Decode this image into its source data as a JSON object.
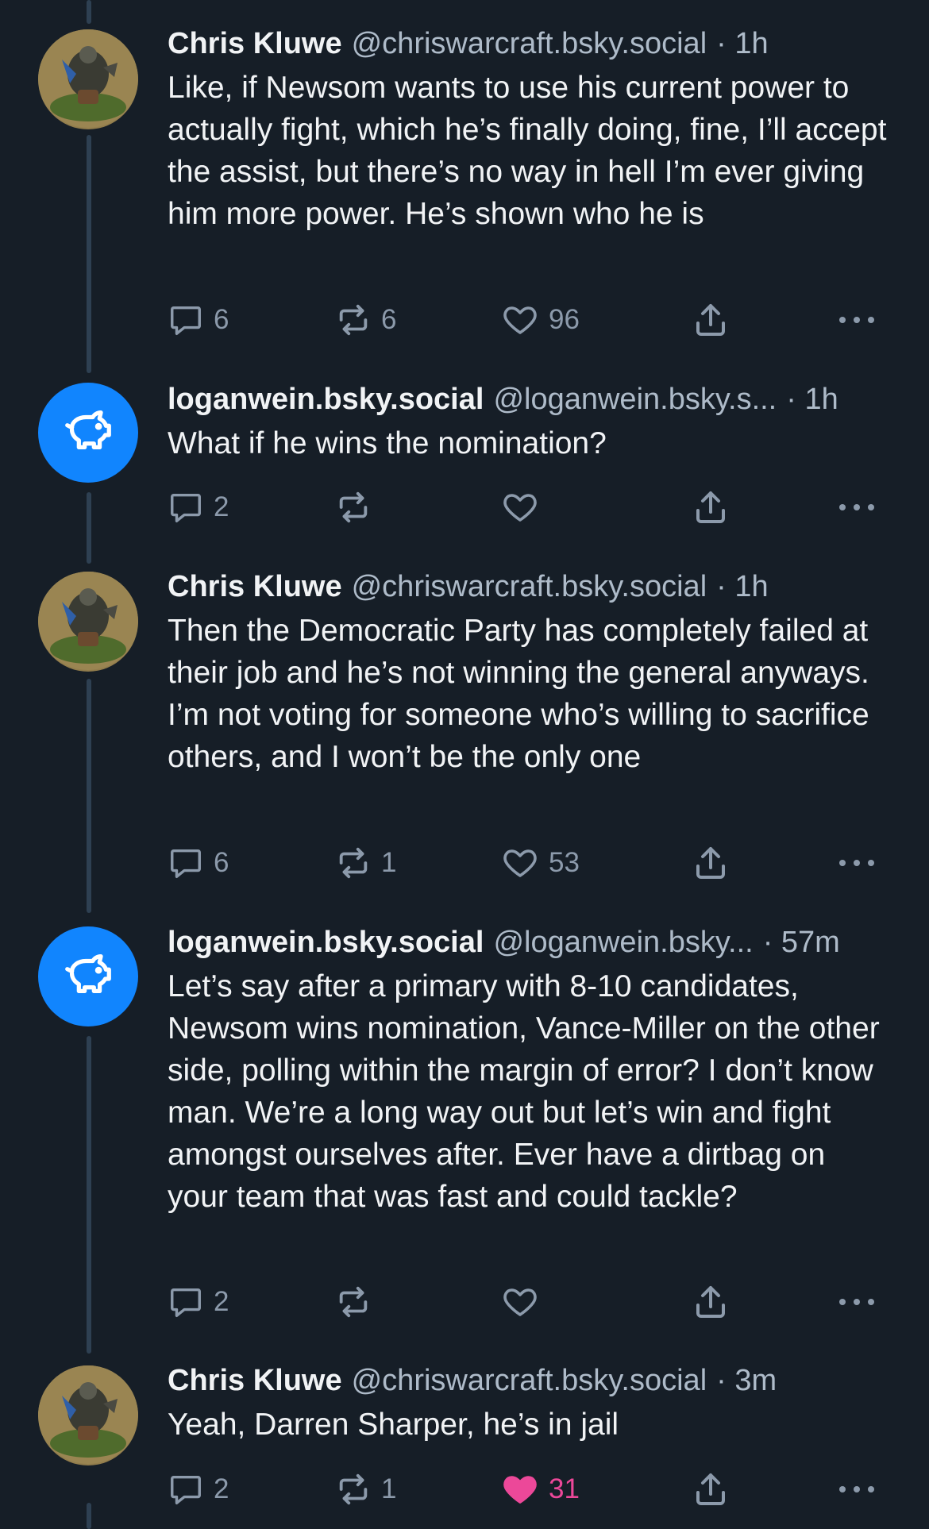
{
  "posts": [
    {
      "author": "Chris Kluwe",
      "handle": "@chriswarcraft.bsky.social",
      "time": "1h",
      "text": "Like, if Newsom wants to use his current power to actually fight, which he’s finally doing, fine, I’ll accept the assist, but there’s no way in hell I’m ever giving him more power. He’s shown who he is",
      "replies": "6",
      "reposts": "6",
      "likes": "96",
      "liked": false,
      "avatar": "miniature-figure-photo"
    },
    {
      "author": "loganwein.bsky.social",
      "handle": "@loganwein.bsky.s...",
      "time": "1h",
      "text": "What if he wins the nomination?",
      "replies": "2",
      "reposts": "",
      "likes": "",
      "liked": false,
      "avatar": "piggy-bank-icon"
    },
    {
      "author": "Chris Kluwe",
      "handle": "@chriswarcraft.bsky.social",
      "time": "1h",
      "text": "Then the Democratic Party has completely failed at their job and he’s not winning the general anyways. I’m not voting for someone who’s willing to sacrifice others, and I won’t be the only one",
      "replies": "6",
      "reposts": "1",
      "likes": "53",
      "liked": false,
      "avatar": "miniature-figure-photo"
    },
    {
      "author": "loganwein.bsky.social",
      "handle": "@loganwein.bsky...",
      "time": "57m",
      "text": "Let’s say after a primary with 8-10 candidates, Newsom wins nomination, Vance-Miller on the other side, polling within the margin of error? I don’t know man. We’re a long way out but let’s win and fight amongst ourselves after. Ever have a dirtbag on your team that was fast and could tackle?",
      "replies": "2",
      "reposts": "",
      "likes": "",
      "liked": false,
      "avatar": "piggy-bank-icon"
    },
    {
      "author": "Chris Kluwe",
      "handle": "@chriswarcraft.bsky.social",
      "time": "3m",
      "text": "Yeah, Darren Sharper, he’s in jail",
      "replies": "2",
      "reposts": "1",
      "likes": "31",
      "liked": true,
      "avatar": "miniature-figure-photo"
    }
  ],
  "colors": {
    "background": "#161e27",
    "text": "#f1f3f5",
    "muted": "#aebbc9",
    "icon": "#8c9aab",
    "accent_blue": "#1185fe",
    "like_pink": "#ec4899",
    "thread_line": "#2e4052"
  }
}
